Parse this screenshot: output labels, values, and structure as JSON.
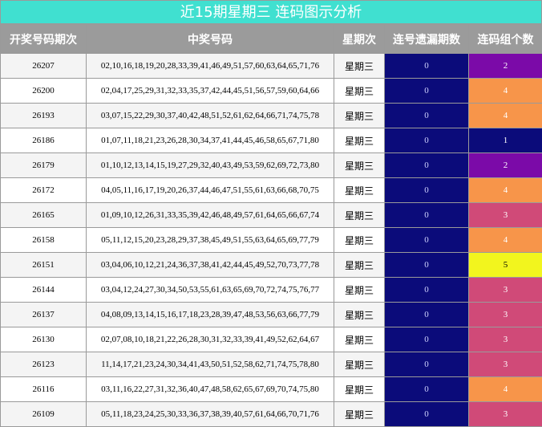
{
  "title": "近15期星期三 连码图示分析",
  "headers": {
    "issue": "开奖号码期次",
    "numbers": "中奖号码",
    "weekday": "星期次",
    "miss": "连号遗漏期数",
    "groups": "连码组个数"
  },
  "group_colors": {
    "1": "#0b0b7a",
    "2": "#7b0aa8",
    "3": "#d04a78",
    "4": "#f7954a",
    "5": "#f2f51e"
  },
  "group_text_colors": {
    "5": "#000000"
  },
  "rows": [
    {
      "issue": "26207",
      "numbers": "02,10,16,18,19,20,28,33,39,41,46,49,51,57,60,63,64,65,71,76",
      "weekday": "星期三",
      "miss": "0",
      "groups": "2"
    },
    {
      "issue": "26200",
      "numbers": "02,04,17,25,29,31,32,33,35,37,42,44,45,51,56,57,59,60,64,66",
      "weekday": "星期三",
      "miss": "0",
      "groups": "4"
    },
    {
      "issue": "26193",
      "numbers": "03,07,15,22,29,30,37,40,42,48,51,52,61,62,64,66,71,74,75,78",
      "weekday": "星期三",
      "miss": "0",
      "groups": "4"
    },
    {
      "issue": "26186",
      "numbers": "01,07,11,18,21,23,26,28,30,34,37,41,44,45,46,58,65,67,71,80",
      "weekday": "星期三",
      "miss": "0",
      "groups": "1"
    },
    {
      "issue": "26179",
      "numbers": "01,10,12,13,14,15,19,27,29,32,40,43,49,53,59,62,69,72,73,80",
      "weekday": "星期三",
      "miss": "0",
      "groups": "2"
    },
    {
      "issue": "26172",
      "numbers": "04,05,11,16,17,19,20,26,37,44,46,47,51,55,61,63,66,68,70,75",
      "weekday": "星期三",
      "miss": "0",
      "groups": "4"
    },
    {
      "issue": "26165",
      "numbers": "01,09,10,12,26,31,33,35,39,42,46,48,49,57,61,64,65,66,67,74",
      "weekday": "星期三",
      "miss": "0",
      "groups": "3"
    },
    {
      "issue": "26158",
      "numbers": "05,11,12,15,20,23,28,29,37,38,45,49,51,55,63,64,65,69,77,79",
      "weekday": "星期三",
      "miss": "0",
      "groups": "4"
    },
    {
      "issue": "26151",
      "numbers": "03,04,06,10,12,21,24,36,37,38,41,42,44,45,49,52,70,73,77,78",
      "weekday": "星期三",
      "miss": "0",
      "groups": "5"
    },
    {
      "issue": "26144",
      "numbers": "03,04,12,24,27,30,34,50,53,55,61,63,65,69,70,72,74,75,76,77",
      "weekday": "星期三",
      "miss": "0",
      "groups": "3"
    },
    {
      "issue": "26137",
      "numbers": "04,08,09,13,14,15,16,17,18,23,28,39,47,48,53,56,63,66,77,79",
      "weekday": "星期三",
      "miss": "0",
      "groups": "3"
    },
    {
      "issue": "26130",
      "numbers": "02,07,08,10,18,21,22,26,28,30,31,32,33,39,41,49,52,62,64,67",
      "weekday": "星期三",
      "miss": "0",
      "groups": "3"
    },
    {
      "issue": "26123",
      "numbers": "11,14,17,21,23,24,30,34,41,43,50,51,52,58,62,71,74,75,78,80",
      "weekday": "星期三",
      "miss": "0",
      "groups": "3"
    },
    {
      "issue": "26116",
      "numbers": "03,11,16,22,27,31,32,36,40,47,48,58,62,65,67,69,70,74,75,80",
      "weekday": "星期三",
      "miss": "0",
      "groups": "4"
    },
    {
      "issue": "26109",
      "numbers": "05,11,18,23,24,25,30,33,36,37,38,39,40,57,61,64,66,70,71,76",
      "weekday": "星期三",
      "miss": "0",
      "groups": "3"
    }
  ]
}
